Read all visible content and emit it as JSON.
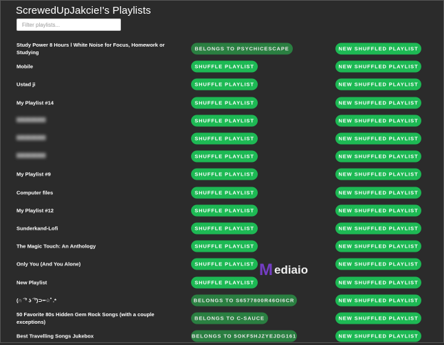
{
  "header": {
    "title": "ScrewedUpJakcie!'s Playlists",
    "filter_placeholder": "Filter playlists..."
  },
  "colors": {
    "accent": "#1db954",
    "owner_button": "#2a7f41",
    "background": "#2b2b2b"
  },
  "playlists": [
    {
      "name": "Study Power 8 Hours l White Noise for Focus, Homework or Studying",
      "action": "BELONGS TO PSYCHICESCAPE",
      "owned": false,
      "new_label": "NEW SHUFFLED PLAYLIST"
    },
    {
      "name": "Mobile",
      "action": "SHUFFLE PLAYLIST",
      "owned": true,
      "new_label": "NEW SHUFFLED PLAYLIST"
    },
    {
      "name": "Ustad ji",
      "action": "SHUFFLE PLAYLIST",
      "owned": true,
      "new_label": "NEW SHUFFLED PLAYLIST"
    },
    {
      "name": "My Playlist #14",
      "action": "SHUFFLE PLAYLIST",
      "owned": true,
      "new_label": "NEW SHUFFLED PLAYLIST"
    },
    {
      "name": "",
      "action": "SHUFFLE PLAYLIST",
      "owned": true,
      "blurred": true,
      "new_label": "NEW SHUFFLED PLAYLIST"
    },
    {
      "name": "",
      "action": "SHUFFLE PLAYLIST",
      "owned": true,
      "blurred": true,
      "new_label": "NEW SHUFFLED PLAYLIST"
    },
    {
      "name": "",
      "action": "SHUFFLE PLAYLIST",
      "owned": true,
      "blurred": true,
      "new_label": "NEW SHUFFLED PLAYLIST"
    },
    {
      "name": "My Playlist #9",
      "action": "SHUFFLE PLAYLIST",
      "owned": true,
      "new_label": "NEW SHUFFLED PLAYLIST"
    },
    {
      "name": "Computer files",
      "action": "SHUFFLE PLAYLIST",
      "owned": true,
      "new_label": "NEW SHUFFLED PLAYLIST"
    },
    {
      "name": "My Playlist #12",
      "action": "SHUFFLE PLAYLIST",
      "owned": true,
      "new_label": "NEW SHUFFLED PLAYLIST"
    },
    {
      "name": "Sunderkand-Lofi",
      "action": "SHUFFLE PLAYLIST",
      "owned": true,
      "new_label": "NEW SHUFFLED PLAYLIST"
    },
    {
      "name": "The Magic Touch: An Anthology",
      "action": "SHUFFLE PLAYLIST",
      "owned": true,
      "new_label": "NEW SHUFFLED PLAYLIST"
    },
    {
      "name": "Only You (And You Alone)",
      "action": "SHUFFLE PLAYLIST",
      "owned": true,
      "new_label": "NEW SHUFFLED PLAYLIST"
    },
    {
      "name": "New Playlist",
      "action": "SHUFFLE PLAYLIST",
      "owned": true,
      "new_label": "NEW SHUFFLED PLAYLIST"
    },
    {
      "name": "(∩ ͡ ° ʖ ͡ °)⊃━☆ﾟ.*",
      "action": "BELONGS TO S6577800R46OI6CR",
      "owned": false,
      "new_label": "NEW SHUFFLED PLAYLIST"
    },
    {
      "name": "50 Favorite 80s Hidden Gem Rock Songs (with a couple exceptions)",
      "action": "BELONGS TO C-SAUCE",
      "owned": false,
      "new_label": "NEW SHUFFLED PLAYLIST"
    },
    {
      "name": "Best Travelling Songs Jukebox",
      "action": "BELONGS TO 5OKF5HJZYEJDG161",
      "owned": false,
      "new_label": "NEW SHUFFLED PLAYLIST"
    }
  ],
  "watermark": {
    "logo_letter": "M",
    "text": "ediaio"
  }
}
